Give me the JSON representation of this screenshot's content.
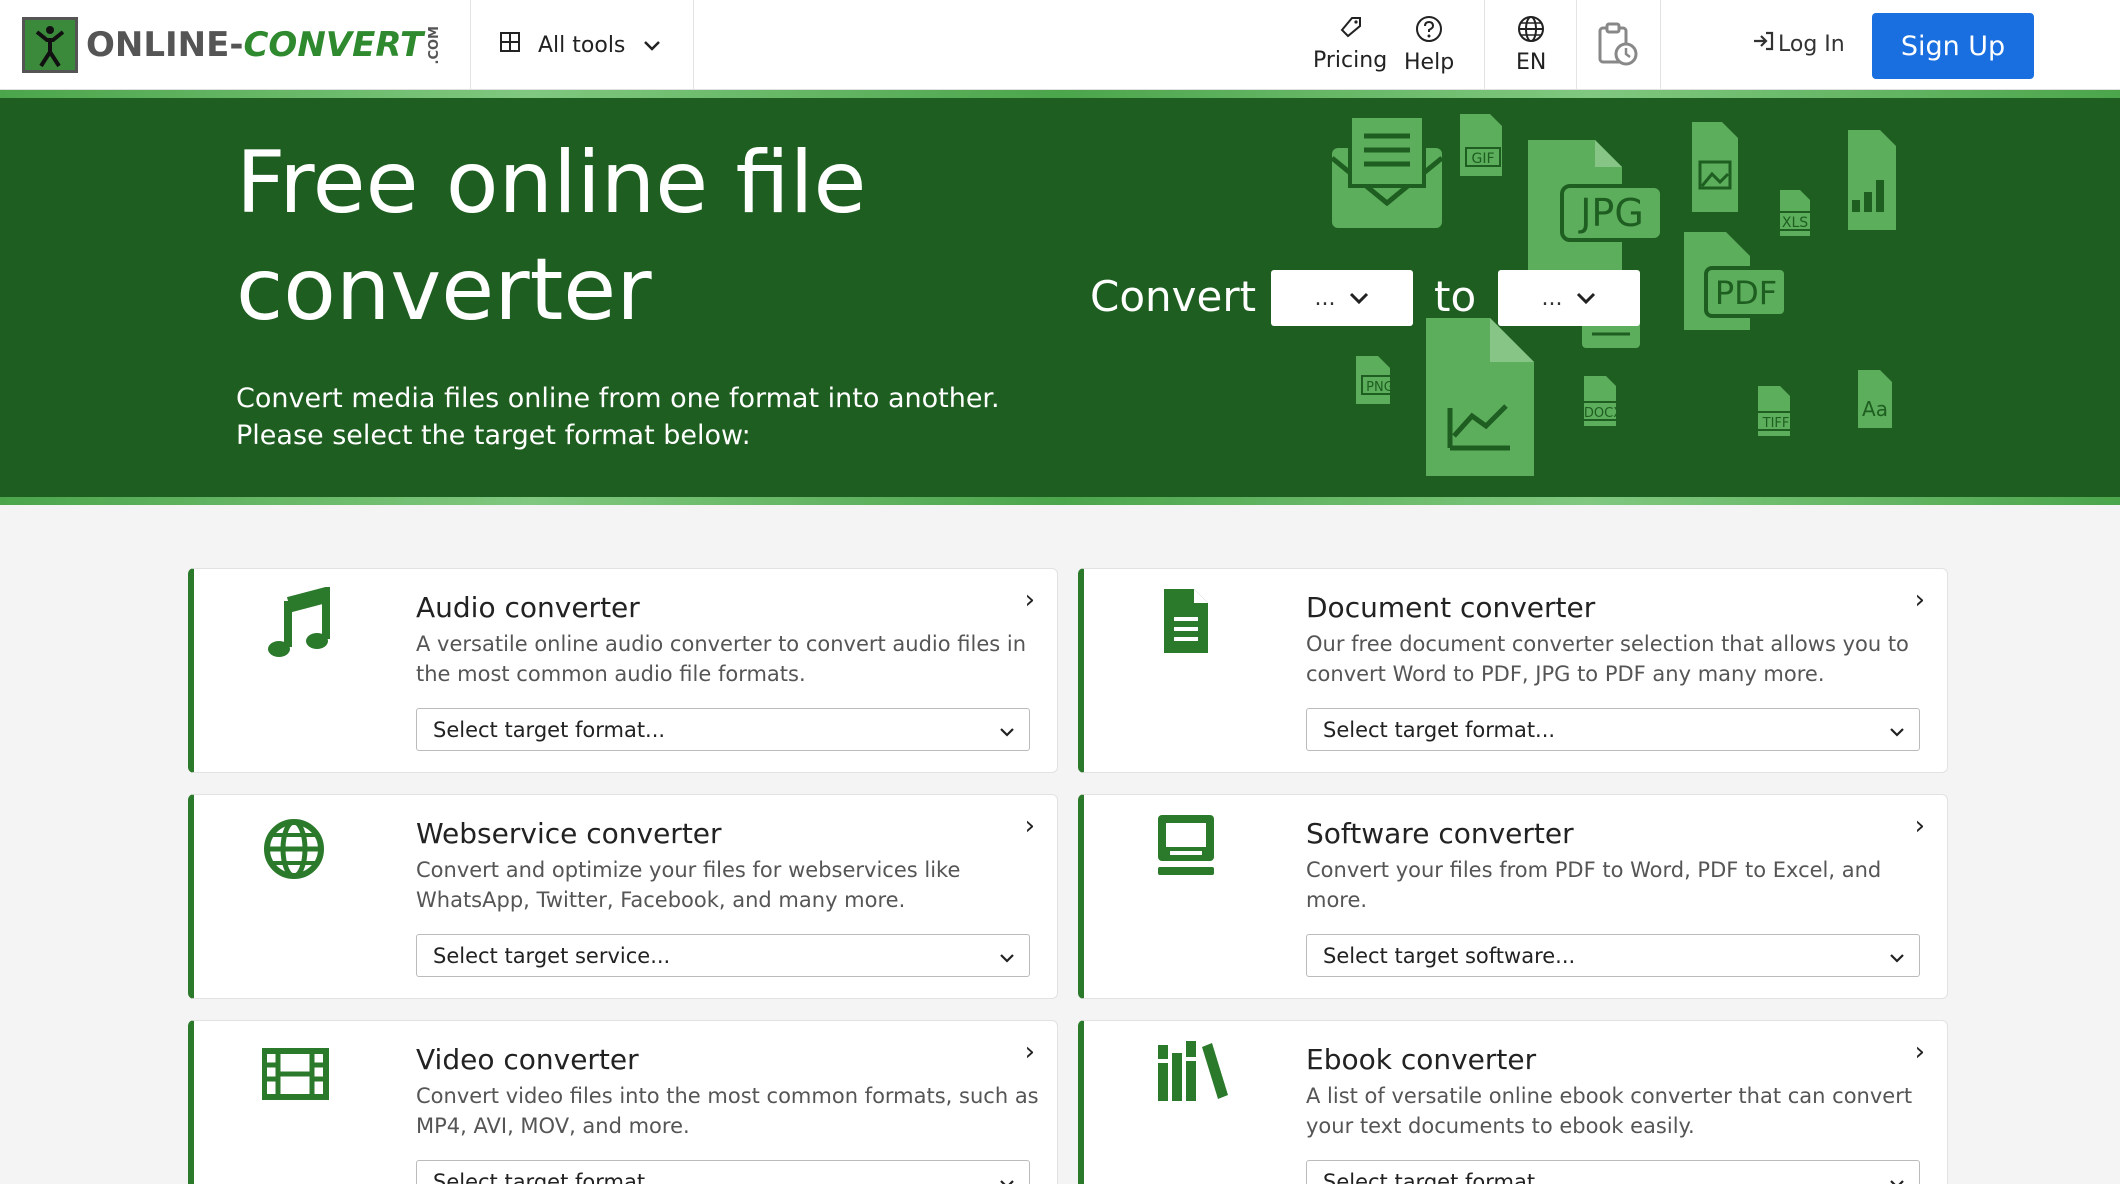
{
  "header": {
    "logo_text_a": "ONLINE-",
    "logo_text_b": "CONVERT",
    "logo_com": ".COM",
    "all_tools": "All tools",
    "pricing": "Pricing",
    "help": "Help",
    "language": "EN",
    "login": "Log In",
    "signup": "Sign Up"
  },
  "hero": {
    "title": "Free online file converter",
    "subtitle": "Convert media files online from one format into another. Please select the target format below:",
    "convert_label": "Convert",
    "to_label": "to",
    "from_value": "...",
    "to_value": "...",
    "file_badges": [
      "GIF",
      "JPG",
      "XLS",
      "PDF",
      "PNG",
      "DOCX",
      "TIFF",
      "Aa"
    ]
  },
  "cards": [
    {
      "title": "Audio converter",
      "desc": "A versatile online audio converter to convert audio files in the most common audio file formats.",
      "select": "Select target format...",
      "icon": "music-note-icon"
    },
    {
      "title": "Document converter",
      "desc": "Our free document converter selection that allows you to convert Word to PDF, JPG to PDF any many more.",
      "select": "Select target format...",
      "icon": "document-icon"
    },
    {
      "title": "Webservice converter",
      "desc": "Convert and optimize your files for webservices like WhatsApp, Twitter, Facebook, and many more.",
      "select": "Select target service...",
      "icon": "globe-icon"
    },
    {
      "title": "Software converter",
      "desc": "Convert your files from PDF to Word, PDF to Excel, and more.",
      "select": "Select target software...",
      "icon": "computer-icon"
    },
    {
      "title": "Video converter",
      "desc": "Convert video files into the most common formats, such as MP4, AVI, MOV, and more.",
      "select": "Select target format...",
      "icon": "film-icon"
    },
    {
      "title": "Ebook converter",
      "desc": "A list of versatile online ebook converter that can convert your text documents to ebook easily.",
      "select": "Select target format...",
      "icon": "books-icon"
    }
  ],
  "colors": {
    "accent": "#1e5e20",
    "card_border": "#2b7a2b",
    "signup": "#1a6fe0",
    "icon_green": "#2b7a2b"
  }
}
